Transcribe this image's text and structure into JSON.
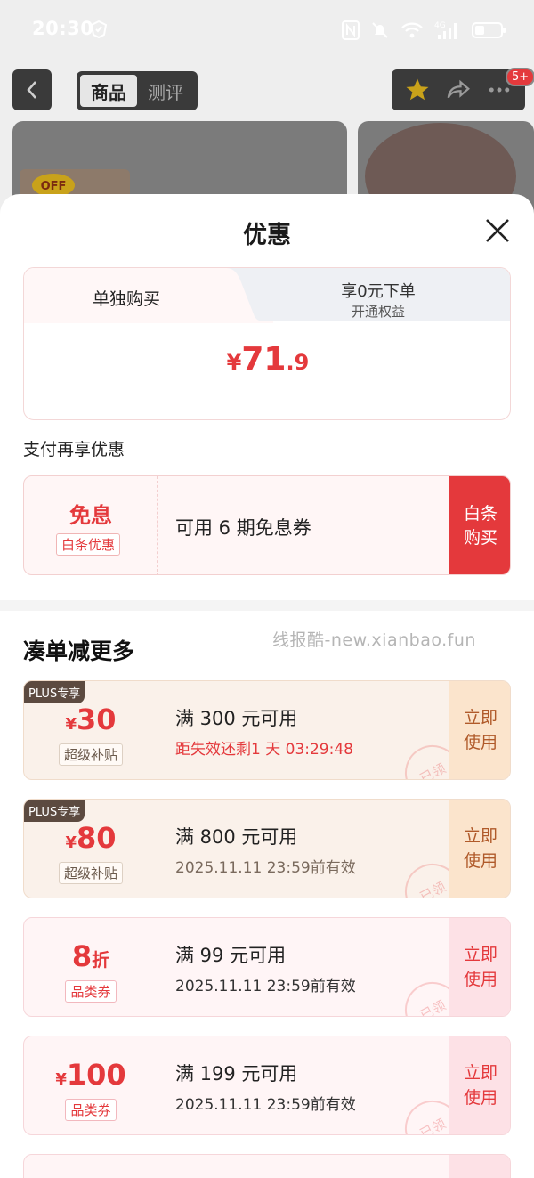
{
  "status_bar": {
    "time": "20:30",
    "network": "4G"
  },
  "background_page": {
    "tabs": [
      "商品",
      "测评"
    ],
    "active_tab": 0,
    "cart_badge": "5+"
  },
  "sheet": {
    "title": "优惠",
    "buy_tabs": {
      "single": "单独购买",
      "zero_line1": "享0元下单",
      "zero_line2": "开通权益"
    },
    "price": {
      "currency": "¥",
      "integer": "71",
      "decimal": ".9"
    },
    "pay_section_label": "支付再享优惠",
    "ious": {
      "main": "免息",
      "sub": "白条优惠",
      "desc": "可用 6 期免息券",
      "button_line1": "白条",
      "button_line2": "购买"
    },
    "more_title": "凑单减更多",
    "watermark": "线报酷-new.xianbao.fun",
    "coupons": [
      {
        "tag": "PLUS专享",
        "currency": "¥",
        "amount": "30",
        "unit": "",
        "sub": "超级补贴",
        "condition": "满 300 元可用",
        "expiry": "距失效还剩1 天 03:29:48",
        "button_line1": "立即",
        "button_line2": "使用",
        "stamp": "已领"
      },
      {
        "tag": "PLUS专享",
        "currency": "¥",
        "amount": "80",
        "unit": "",
        "sub": "超级补贴",
        "condition": "满 800 元可用",
        "expiry": "2025.11.11 23:59前有效",
        "button_line1": "立即",
        "button_line2": "使用",
        "stamp": "已领"
      },
      {
        "tag": "",
        "currency": "",
        "amount": "8",
        "unit": "折",
        "sub": "品类券",
        "condition": "满 99 元可用",
        "expiry": "2025.11.11 23:59前有效",
        "button_line1": "立即",
        "button_line2": "使用",
        "stamp": "已领"
      },
      {
        "tag": "",
        "currency": "¥",
        "amount": "100",
        "unit": "",
        "sub": "品类券",
        "condition": "满 199 元可用",
        "expiry": "2025.11.11 23:59前有效",
        "button_line1": "立即",
        "button_line2": "使用",
        "stamp": "已领"
      }
    ]
  },
  "colors": {
    "accent_red": "#e4393c",
    "plus_bg": "#faf1ea",
    "category_bg": "#fff5f6"
  }
}
